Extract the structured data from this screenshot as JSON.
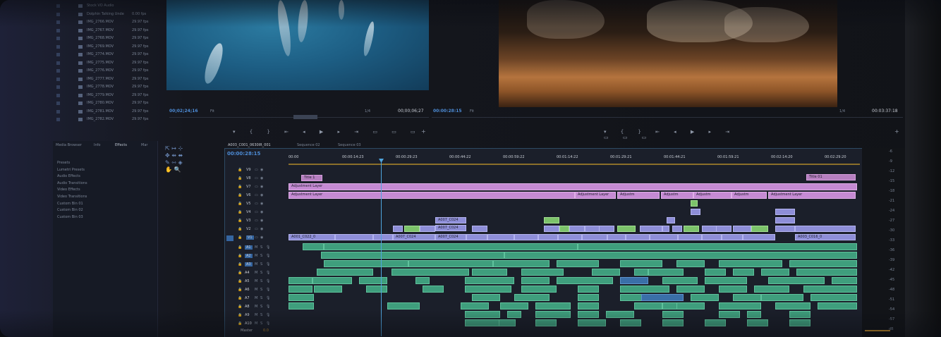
{
  "project_panel": {
    "rows": [
      {
        "name": "Stock VO Audio",
        "fps": ""
      },
      {
        "name": "Dolphin Talking Unde",
        "fps": "0.00 fps"
      },
      {
        "name": "IMG_2766.MOV",
        "fps": "29.97 fps"
      },
      {
        "name": "IMG_2767.MOV",
        "fps": "29.97 fps"
      },
      {
        "name": "IMG_2768.MOV",
        "fps": "29.97 fps"
      },
      {
        "name": "IMG_2769.MOV",
        "fps": "29.97 fps"
      },
      {
        "name": "IMG_2774.MOV",
        "fps": "29.97 fps"
      },
      {
        "name": "IMG_2775.MOV",
        "fps": "29.97 fps"
      },
      {
        "name": "IMG_2776.MOV",
        "fps": "29.97 fps"
      },
      {
        "name": "IMG_2777.MOV",
        "fps": "29.97 fps"
      },
      {
        "name": "IMG_2778.MOV",
        "fps": "29.97 fps"
      },
      {
        "name": "IMG_2779.MOV",
        "fps": "29.97 fps"
      },
      {
        "name": "IMG_2780.MOV",
        "fps": "29.97 fps"
      },
      {
        "name": "IMG_2781.MOV",
        "fps": "29.97 fps"
      },
      {
        "name": "IMG_2782.MOV",
        "fps": "29.97 fps"
      }
    ]
  },
  "source_monitor": {
    "timecode": "00;02;24;16",
    "fit": "Fit",
    "resolution": "1/4",
    "duration": "00;00;06;27"
  },
  "program_monitor": {
    "timecode": "00:00:28:15",
    "fit": "Fit",
    "resolution": "1/4",
    "duration": "00:03:37:18"
  },
  "effects_panel": {
    "tabs": [
      "Media Browser",
      "Info",
      "Effects",
      "Mar"
    ],
    "items": [
      "Presets",
      "Lumetri Presets",
      "Audio Effects",
      "Audio Transitions",
      "Video Effects",
      "Video Transitions",
      "Custom Bin 01",
      "Custom Bin 02",
      "Custom Bin 03"
    ]
  },
  "timeline": {
    "tabs": [
      "A003_C001_0630IR_001",
      "Sequence 02",
      "Sequence 03"
    ],
    "timecode": "00:00:28:15",
    "ruler": [
      "00:00",
      "00:00:14:23",
      "00:00:29:23",
      "00:00:44:22",
      "00:00:59:22",
      "00:01:14:22",
      "00:01:29:21",
      "00:01:44:21",
      "00:01:59:21",
      "00:02:14:20",
      "00:02:29:20"
    ],
    "video_tracks": [
      "V9",
      "V8",
      "V7",
      "V6",
      "V5",
      "V4",
      "V3",
      "V2",
      "V1"
    ],
    "audio_tracks": [
      "A1",
      "A2",
      "A3",
      "A4",
      "A5",
      "A6",
      "A7",
      "A8",
      "A9",
      "A10"
    ],
    "master": {
      "label": "Master",
      "value": "0.0"
    },
    "clip_labels": {
      "title1": "Title 1",
      "title01": "Title 01",
      "adjustment": "Adjustment Layer",
      "adjustment_short": "Adjustm",
      "c024": "A007_C024",
      "c022": "A001_C022_0",
      "c016": "A003_C016_0"
    }
  },
  "meter_scale": [
    "-6",
    "-9",
    "-12",
    "-15",
    "-18",
    "-21",
    "-24",
    "-27",
    "-30",
    "-33",
    "-36",
    "-39",
    "-42",
    "-45",
    "-48",
    "-51",
    "-54",
    "-57",
    "dB"
  ]
}
